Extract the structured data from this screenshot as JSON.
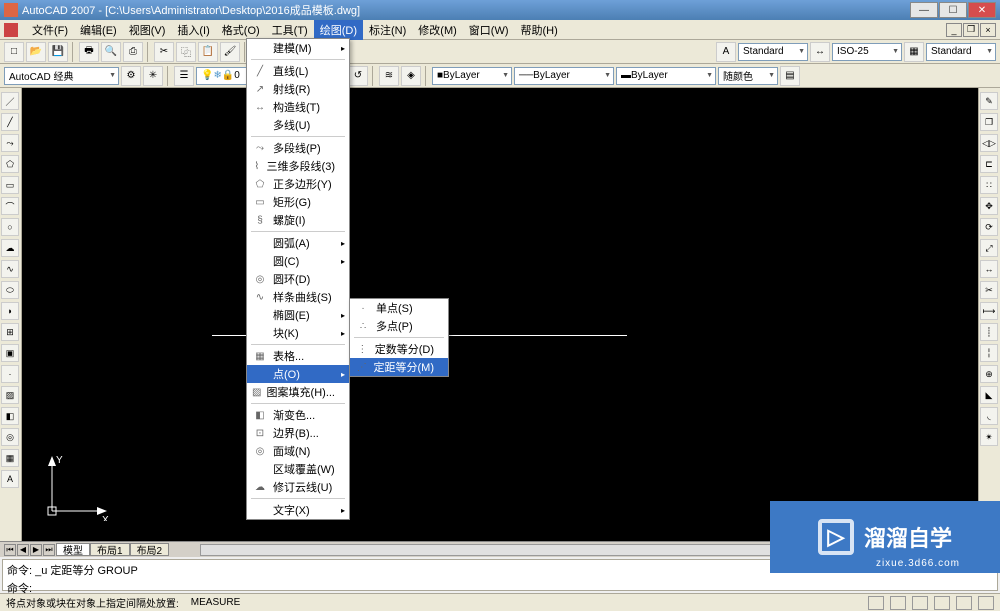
{
  "title": "AutoCAD 2007 - [C:\\Users\\Administrator\\Desktop\\2016成品模板.dwg]",
  "menus": {
    "file": "文件(F)",
    "edit": "编辑(E)",
    "view": "视图(V)",
    "insert": "插入(I)",
    "format": "格式(O)",
    "tools": "工具(T)",
    "draw": "绘图(D)",
    "dim": "标注(N)",
    "modify": "修改(M)",
    "window": "窗口(W)",
    "help": "帮助(H)"
  },
  "workspace": "AutoCAD 经典",
  "tb1": {
    "style": "Standard",
    "dim": "ISO-25",
    "table": "Standard"
  },
  "tb2": {
    "layer_color": "ByLayer",
    "linetype": "ByLayer",
    "lineweight": "ByLayer",
    "plot": "随颜色"
  },
  "draw_menu": {
    "model": "建模(M)",
    "line": "直线(L)",
    "ray": "射线(R)",
    "xline": "构造线(T)",
    "mline": "多线(U)",
    "pline": "多段线(P)",
    "3dpoly": "三维多段线(3)",
    "polygon": "正多边形(Y)",
    "rect": "矩形(G)",
    "helix": "螺旋(I)",
    "arc": "圆弧(A)",
    "circle": "圆(C)",
    "donut": "圆环(D)",
    "spline": "样条曲线(S)",
    "ellipse": "椭圆(E)",
    "block": "块(K)",
    "table": "表格...",
    "point": "点(O)",
    "hatch": "图案填充(H)...",
    "gradient": "渐变色...",
    "boundary": "边界(B)...",
    "region": "面域(N)",
    "wipeout": "区域覆盖(W)",
    "revcloud": "修订云线(U)",
    "text": "文字(X)"
  },
  "point_sub": {
    "single": "单点(S)",
    "multi": "多点(P)",
    "divide": "定数等分(D)",
    "measure": "定距等分(M)"
  },
  "tabs": {
    "model": "模型",
    "l1": "布局1",
    "l2": "布局2"
  },
  "cmd": {
    "l1": "命令: _u 定距等分 GROUP",
    "l2": "命令:",
    "status": "将点对象或块在对象上指定间隔处放置:",
    "mode": "MEASURE"
  },
  "ucs": {
    "x": "X",
    "y": "Y"
  },
  "watermark": {
    "main": "溜溜自学",
    "sub": "zixue.3d66.com"
  }
}
